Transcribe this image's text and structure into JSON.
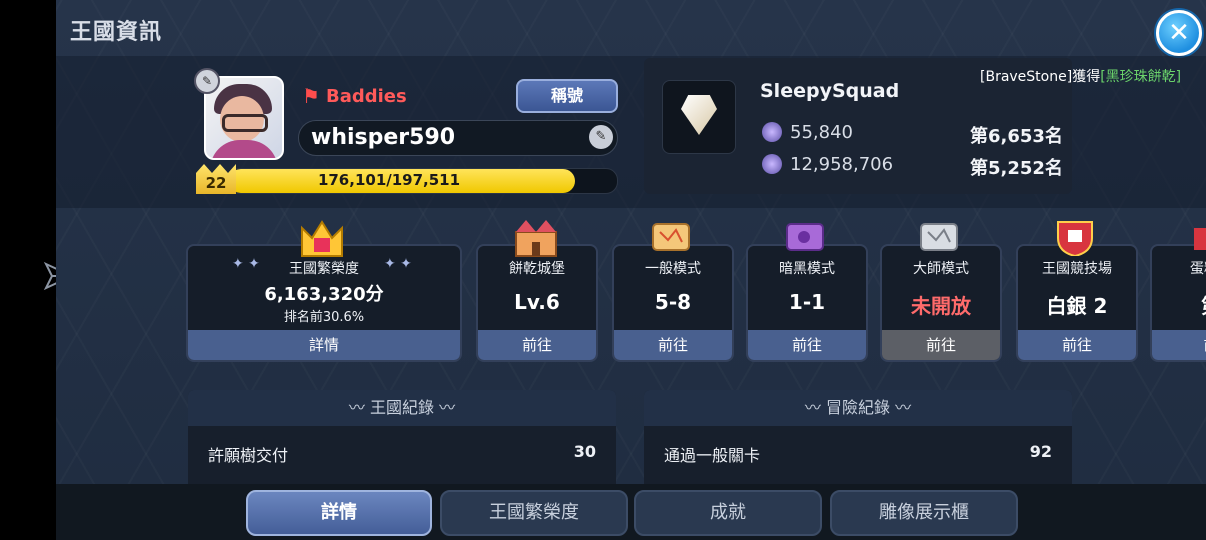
{
  "window": {
    "title": "王國資訊"
  },
  "player": {
    "guild_name": "Baddies",
    "title_button": "稱號",
    "name": "whisper590",
    "level": "22",
    "xp_text": "176,101/197,511",
    "xp_fraction": 0.8916
  },
  "guild": {
    "team_name": "SleepySquad",
    "stat1_value": "55,840",
    "stat1_rank": "第6,653名",
    "stat2_value": "12,958,706",
    "stat2_rank": "第5,252名"
  },
  "notice": {
    "prefix": "[BraveStone]獲得",
    "highlight": "[黑珍珠餅乾]"
  },
  "cards": [
    {
      "label": "王國繁榮度",
      "value": "6,163,320分",
      "sub": "排名前30.6%",
      "button": "詳情"
    },
    {
      "label": "餅乾城堡",
      "value": "Lv.6",
      "button": "前往"
    },
    {
      "label": "一般模式",
      "value": "5-8",
      "button": "前往"
    },
    {
      "label": "暗黑模式",
      "value": "1-1",
      "button": "前往"
    },
    {
      "label": "大師模式",
      "value": "未開放",
      "button": "前往"
    },
    {
      "label": "王國競技場",
      "value": "白銀 2",
      "button": "前往"
    },
    {
      "label": "蛋糕塔",
      "value": "第",
      "button": "前"
    }
  ],
  "records": {
    "kingdom": {
      "title": "王國紀錄",
      "rows": [
        {
          "label": "許願樹交付",
          "value": "30"
        }
      ]
    },
    "adventure": {
      "title": "冒險紀錄",
      "rows": [
        {
          "label": "通過一般關卡",
          "value": "92"
        }
      ]
    }
  },
  "tabs": [
    "詳情",
    "王國繁榮度",
    "成就",
    "雕像展示櫃"
  ],
  "colors": {
    "accent_blue": "#49608f",
    "xp_yellow": "#ffe45a",
    "guild_red": "#ff5a5a",
    "notice_green": "#6bd36b"
  }
}
